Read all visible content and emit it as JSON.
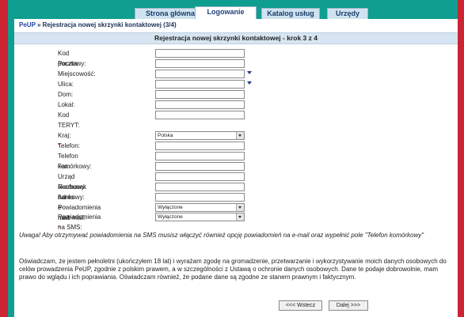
{
  "tabs": [
    {
      "label": "Strona główna"
    },
    {
      "label": "Logowanie"
    },
    {
      "label": "Katalog usług"
    },
    {
      "label": "Urzędy"
    }
  ],
  "breadcrumb": {
    "root": "PeUP",
    "separator": " » ",
    "current": "Rejestracja nowej skrzynki kontaktowej (3/4)"
  },
  "step_header": "Rejestracja nowej skrzynki kontaktowej - krok 3 z 4",
  "address_fields": [
    {
      "label": "Kod pocztowy:"
    },
    {
      "label": "Poczta:"
    },
    {
      "label": "Miejscowość:"
    },
    {
      "label": "Ulica:"
    },
    {
      "label": "Dom:"
    },
    {
      "label": "Lokal:"
    },
    {
      "label": "Kod TERYT:"
    }
  ],
  "contact": {
    "country_label": "Kraj:",
    "country_value": "Polska",
    "phone_label": "Telefon:",
    "mobile_label": "Telefon komórkowy:",
    "fax_label": "Fax:",
    "tax_office_label": "Urząd skarbowy:",
    "bank_label": "Rachunek bankowy:",
    "email_label": "Adres e-mail:",
    "email_notify_label": "Powiadomienia na e-mail:",
    "email_notify_value": "Wyłączone",
    "sms_notify_label": "Powiadomienia na SMS:",
    "sms_notify_value": "Wyłączone",
    "required_mark": "*"
  },
  "note": "Uwaga! Aby otrzymywać powiadomienia na SMS musisz włączyć również opcję powiadomień na e-mail oraz wypełnić pole \"Telefon komórkowy\"",
  "declaration": "Oświadczam, że jestem pełnoletni (ukończyłem 18 lat) i wyrażam zgodę na gromadzenie, przetwarzanie i wykorzystywanie moich danych osobowych do celów prowadzenia PeUP, zgodnie z polskim prawem, a w szczególności z Ustawą o ochronie danych osobowych. Dane te podaje dobrowolnie, mam prawo do wglądu i ich poprawiania. Oświadczam również, że podane dane są zgodne ze stanem prawnym i faktycznym.",
  "buttons": {
    "back": "<<< Wstecz",
    "next": "Dalej >>>"
  },
  "colors": {
    "teal": "#0f9e8f",
    "red": "#cc2433",
    "header": "#d7e5f2",
    "link": "#1c3fa8"
  }
}
